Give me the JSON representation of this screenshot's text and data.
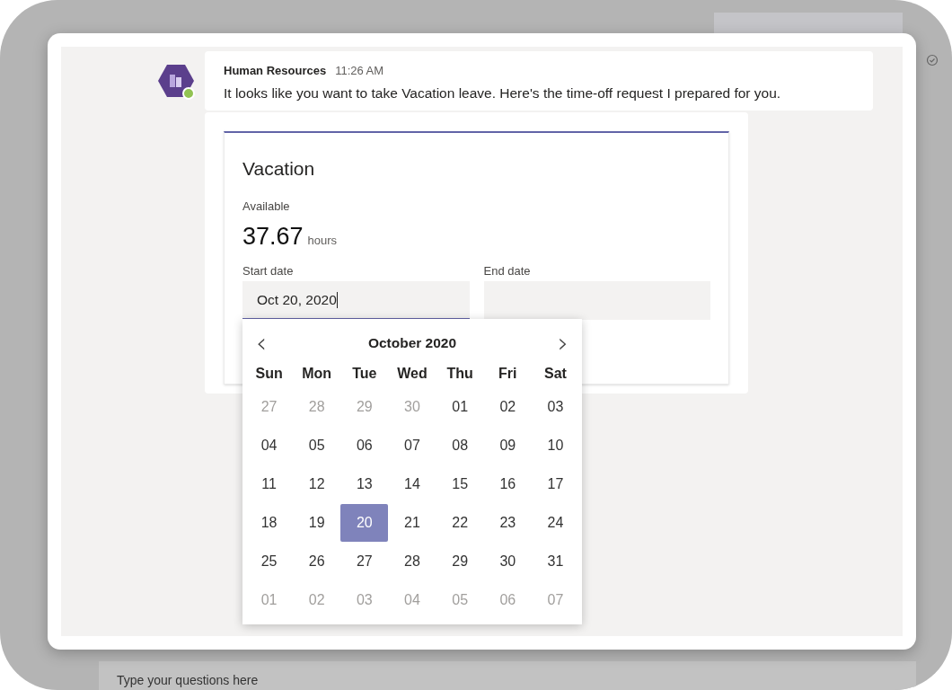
{
  "background": {
    "compose_placeholder": "Type your questions here"
  },
  "message": {
    "sender": "Human Resources",
    "time": "11:26 AM",
    "text": "It looks like you want to take Vacation leave. Here's the time-off request I prepared for you."
  },
  "card": {
    "title": "Vacation",
    "available_label": "Available",
    "available_value": "37.67",
    "available_unit": "hours",
    "start_date": {
      "label": "Start date",
      "value": "Oct 20, 2020",
      "focused": true
    },
    "end_date": {
      "label": "End date"
    }
  },
  "calendar": {
    "prev": "‹",
    "next": "›",
    "month": "October 2020",
    "weekdays": [
      "Sun",
      "Mon",
      "Tue",
      "Wed",
      "Thu",
      "Fri",
      "Sat"
    ],
    "weeks": [
      [
        {
          "label": "27",
          "in_month": false,
          "selected": false
        },
        {
          "label": "28",
          "in_month": false,
          "selected": false
        },
        {
          "label": "29",
          "in_month": false,
          "selected": false
        },
        {
          "label": "30",
          "in_month": false,
          "selected": false
        },
        {
          "label": "01",
          "in_month": true,
          "selected": false
        },
        {
          "label": "02",
          "in_month": true,
          "selected": false
        },
        {
          "label": "03",
          "in_month": true,
          "selected": false
        }
      ],
      [
        {
          "label": "04",
          "in_month": true,
          "selected": false
        },
        {
          "label": "05",
          "in_month": true,
          "selected": false
        },
        {
          "label": "06",
          "in_month": true,
          "selected": false
        },
        {
          "label": "07",
          "in_month": true,
          "selected": false
        },
        {
          "label": "08",
          "in_month": true,
          "selected": false
        },
        {
          "label": "09",
          "in_month": true,
          "selected": false
        },
        {
          "label": "10",
          "in_month": true,
          "selected": false
        }
      ],
      [
        {
          "label": "11",
          "in_month": true,
          "selected": false
        },
        {
          "label": "12",
          "in_month": true,
          "selected": false
        },
        {
          "label": "13",
          "in_month": true,
          "selected": false
        },
        {
          "label": "14",
          "in_month": true,
          "selected": false
        },
        {
          "label": "15",
          "in_month": true,
          "selected": false
        },
        {
          "label": "16",
          "in_month": true,
          "selected": false
        },
        {
          "label": "17",
          "in_month": true,
          "selected": false
        }
      ],
      [
        {
          "label": "18",
          "in_month": true,
          "selected": false
        },
        {
          "label": "19",
          "in_month": true,
          "selected": false
        },
        {
          "label": "20",
          "in_month": true,
          "selected": true
        },
        {
          "label": "21",
          "in_month": true,
          "selected": false
        },
        {
          "label": "22",
          "in_month": true,
          "selected": false
        },
        {
          "label": "23",
          "in_month": true,
          "selected": false
        },
        {
          "label": "24",
          "in_month": true,
          "selected": false
        }
      ],
      [
        {
          "label": "25",
          "in_month": true,
          "selected": false
        },
        {
          "label": "26",
          "in_month": true,
          "selected": false
        },
        {
          "label": "27",
          "in_month": true,
          "selected": false
        },
        {
          "label": "28",
          "in_month": true,
          "selected": false
        },
        {
          "label": "29",
          "in_month": true,
          "selected": false
        },
        {
          "label": "30",
          "in_month": true,
          "selected": false
        },
        {
          "label": "31",
          "in_month": true,
          "selected": false
        }
      ],
      [
        {
          "label": "01",
          "in_month": false,
          "selected": false
        },
        {
          "label": "02",
          "in_month": false,
          "selected": false
        },
        {
          "label": "03",
          "in_month": false,
          "selected": false
        },
        {
          "label": "04",
          "in_month": false,
          "selected": false
        },
        {
          "label": "05",
          "in_month": false,
          "selected": false
        },
        {
          "label": "06",
          "in_month": false,
          "selected": false
        },
        {
          "label": "07",
          "in_month": false,
          "selected": false
        }
      ]
    ]
  }
}
